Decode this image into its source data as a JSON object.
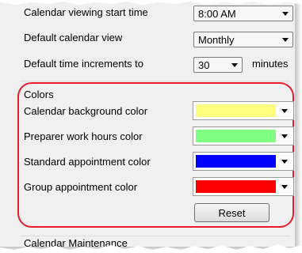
{
  "settings": {
    "start_time_label": "Calendar viewing start time",
    "start_time_value": "8:00 AM",
    "default_view_label": "Default calendar view",
    "default_view_value": "Monthly",
    "increments_label": "Default time increments to",
    "increments_value": "30",
    "increments_unit": "minutes"
  },
  "colors": {
    "group_title": "Colors",
    "items": [
      {
        "label": "Calendar background color",
        "color": "#ffff80"
      },
      {
        "label": "Preparer work hours color",
        "color": "#80ff80"
      },
      {
        "label": "Standard appointment color",
        "color": "#0000ff"
      },
      {
        "label": "Group appointment color",
        "color": "#ff0000"
      }
    ],
    "reset_label": "Reset"
  },
  "maintenance": {
    "group_title": "Calendar Maintenance"
  },
  "icons": {
    "dropdown": "chevron-down-icon"
  }
}
